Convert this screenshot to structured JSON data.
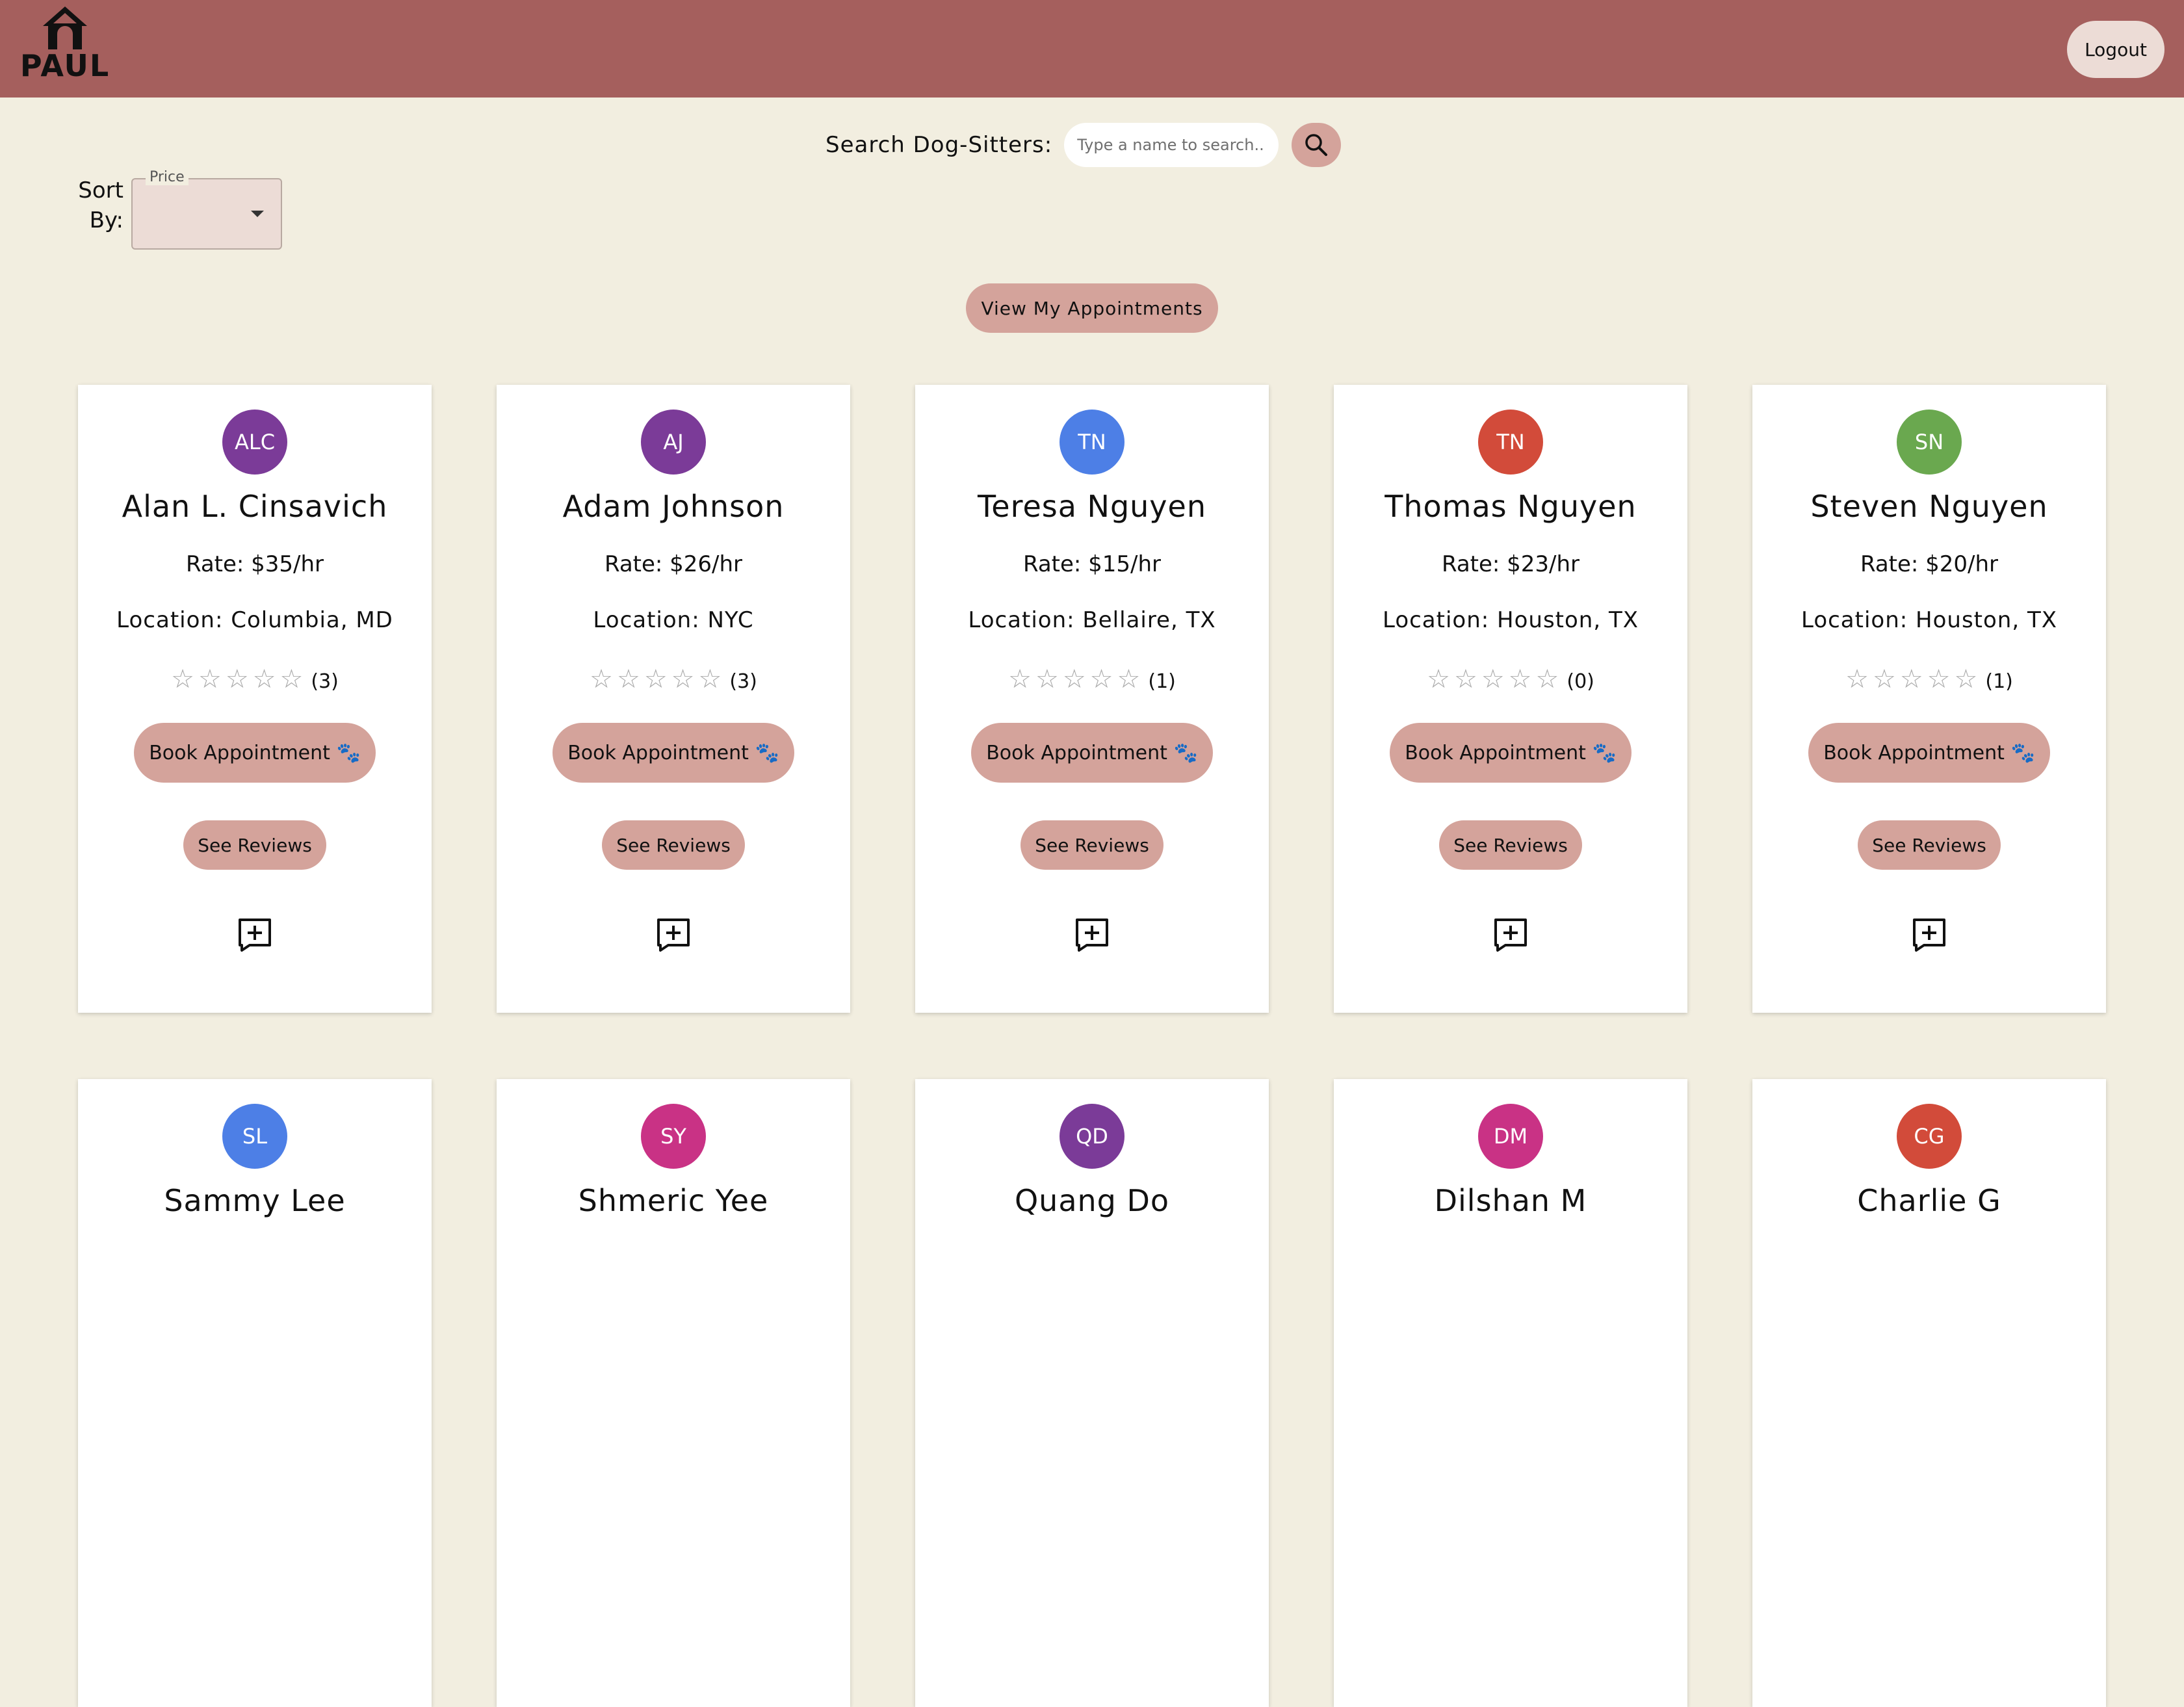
{
  "header": {
    "brand_name": "PAUL",
    "logout_label": "Logout",
    "bg_color": "#a55f5d"
  },
  "search": {
    "label": "Search Dog-Sitters:",
    "placeholder": "Type a name to search...",
    "button_icon": "search-icon"
  },
  "sort": {
    "label": "Sort By:",
    "legend": "Price",
    "value": ""
  },
  "appointments_button": "View My Appointments",
  "card_actions": {
    "book_label": "Book Appointment 🐾",
    "reviews_label": "See Reviews",
    "add_icon": "add-comment-icon"
  },
  "sitters": [
    {
      "initials": "ALC",
      "name": "Alan L. Cinsavich",
      "rate": "Rate: $35/hr",
      "location": "Location: Columbia, MD",
      "stars": "☆☆☆☆☆",
      "review_count": "(3)",
      "avatar_color": "#7b3b98"
    },
    {
      "initials": "AJ",
      "name": "Adam Johnson",
      "rate": "Rate: $26/hr",
      "location": "Location: NYC",
      "stars": "☆☆☆☆☆",
      "review_count": "(3)",
      "avatar_color": "#7b3b98"
    },
    {
      "initials": "TN",
      "name": "Teresa Nguyen",
      "rate": "Rate: $15/hr",
      "location": "Location: Bellaire, TX",
      "stars": "☆☆☆☆☆",
      "review_count": "(1)",
      "avatar_color": "#4d7fe6"
    },
    {
      "initials": "TN",
      "name": "Thomas Nguyen",
      "rate": "Rate: $23/hr",
      "location": "Location: Houston, TX",
      "stars": "☆☆☆☆☆",
      "review_count": "(0)",
      "avatar_color": "#d24b3a"
    },
    {
      "initials": "SN",
      "name": "Steven Nguyen",
      "rate": "Rate: $20/hr",
      "location": "Location: Houston, TX",
      "stars": "☆☆☆☆☆",
      "review_count": "(1)",
      "avatar_color": "#6aa84f"
    },
    {
      "initials": "SL",
      "name": "Sammy Lee",
      "avatar_color": "#4d7fe6"
    },
    {
      "initials": "SY",
      "name": "Shmeric Yee",
      "avatar_color": "#c93285"
    },
    {
      "initials": "QD",
      "name": "Quang Do",
      "avatar_color": "#7b3b98"
    },
    {
      "initials": "DM",
      "name": "Dilshan M",
      "avatar_color": "#c93285"
    },
    {
      "initials": "CG",
      "name": "Charlie G",
      "avatar_color": "#d24b3a"
    }
  ]
}
